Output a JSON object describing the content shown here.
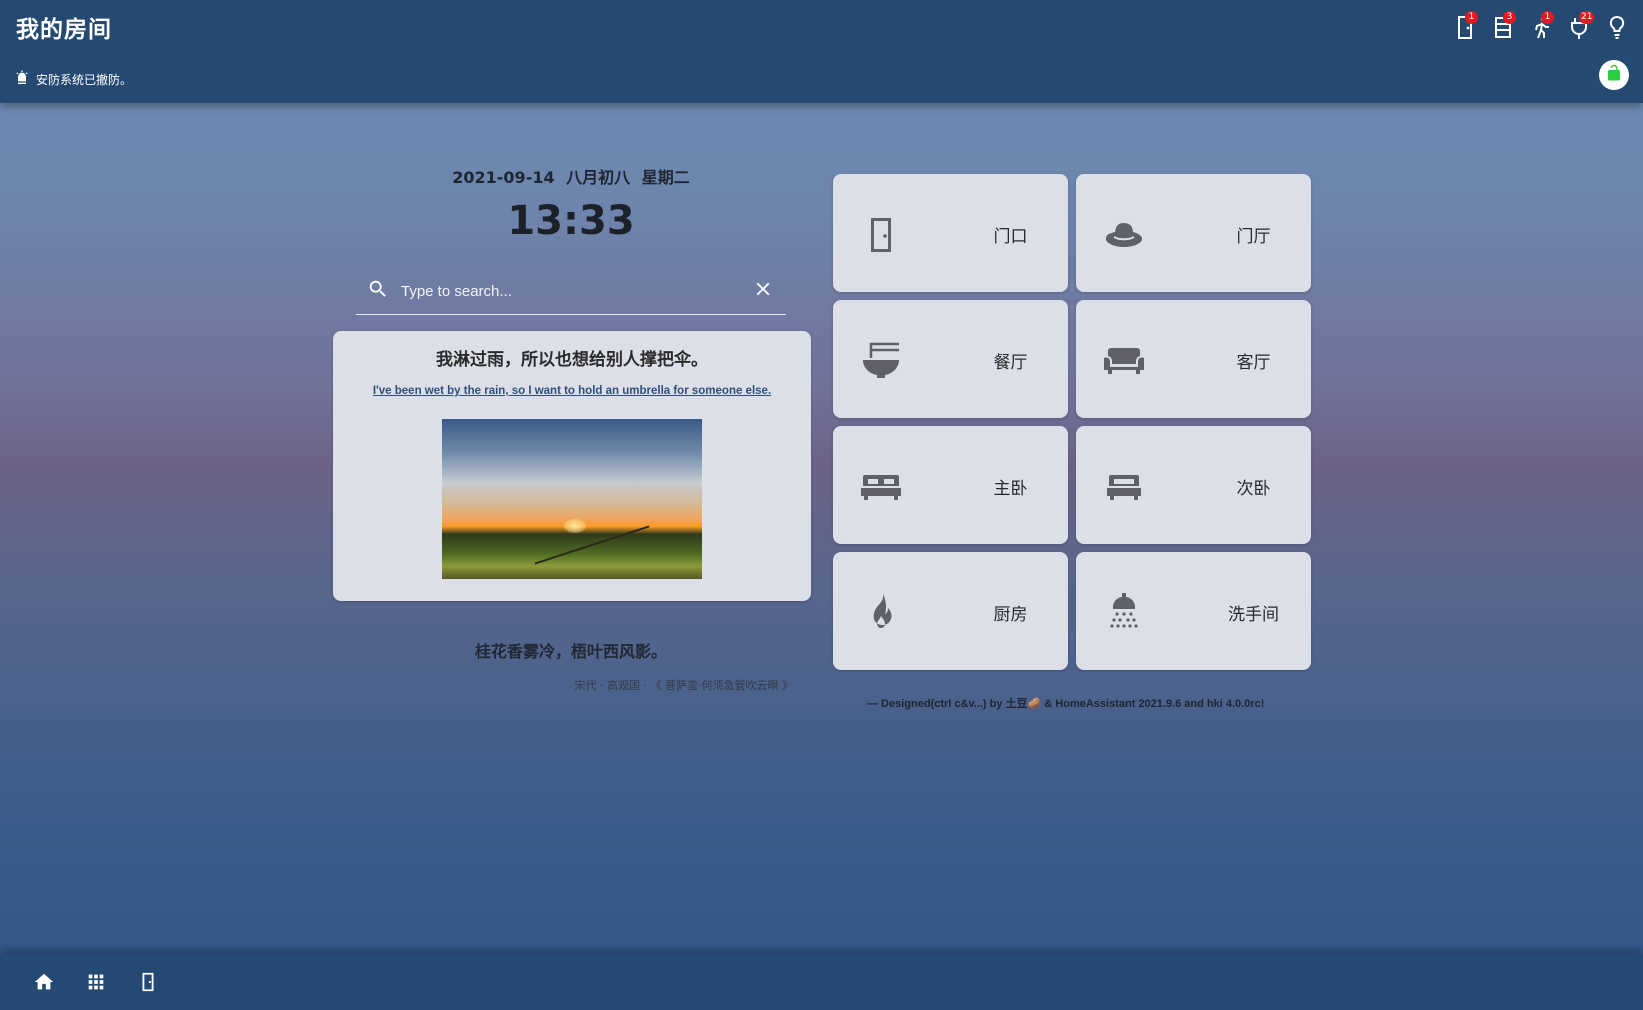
{
  "header": {
    "title": "我的房间",
    "alarm_status": "安防系统已撤防。",
    "icons": [
      {
        "name": "door-sensor-icon",
        "badge": "1"
      },
      {
        "name": "list-icon",
        "badge": "3"
      },
      {
        "name": "motion-icon",
        "badge": "1"
      },
      {
        "name": "plug-icon",
        "badge": "21"
      },
      {
        "name": "lightbulb-icon",
        "badge": ""
      }
    ],
    "lock_icon": "lock-open-icon",
    "lock_color": "#2ecc40"
  },
  "main": {
    "date": "2021-09-14  八月初八  星期二",
    "time": "13:33",
    "search": {
      "placeholder": "Type to search...",
      "value": ""
    }
  },
  "quote_card": {
    "title": "我淋过雨，所以也想给别人撑把伞。",
    "link_text": "I've been wet by the rain, so I want to hold an umbrella for someone else."
  },
  "poem": {
    "line": "桂花香雾冷，梧叶西风影。",
    "source": "宋代 · 高观国 · 《 菩萨蛮·何须急管吹云暝 》"
  },
  "rooms": [
    {
      "label": "门口",
      "icon": "door-icon"
    },
    {
      "label": "门厅",
      "icon": "hat-icon"
    },
    {
      "label": "餐厅",
      "icon": "noodle-bowl-icon"
    },
    {
      "label": "客厅",
      "icon": "sofa-icon"
    },
    {
      "label": "主卧",
      "icon": "bed-icon"
    },
    {
      "label": "次卧",
      "icon": "bed-single-icon"
    },
    {
      "label": "厨房",
      "icon": "fire-icon"
    },
    {
      "label": "洗手间",
      "icon": "shower-icon"
    }
  ],
  "credits": "— Designed(ctrl c&v...) by 土豆🥔  &  HomeAssistant 2021.9.6 and hki 4.0.0rc!",
  "bottom_nav": [
    {
      "name": "home-icon"
    },
    {
      "name": "apps-grid-icon"
    },
    {
      "name": "door-icon"
    }
  ],
  "colors": {
    "header_bg": "#244a72",
    "card_bg": "#dddfe8",
    "badge": "#e11b22",
    "icon_gray": "#5f6068"
  }
}
